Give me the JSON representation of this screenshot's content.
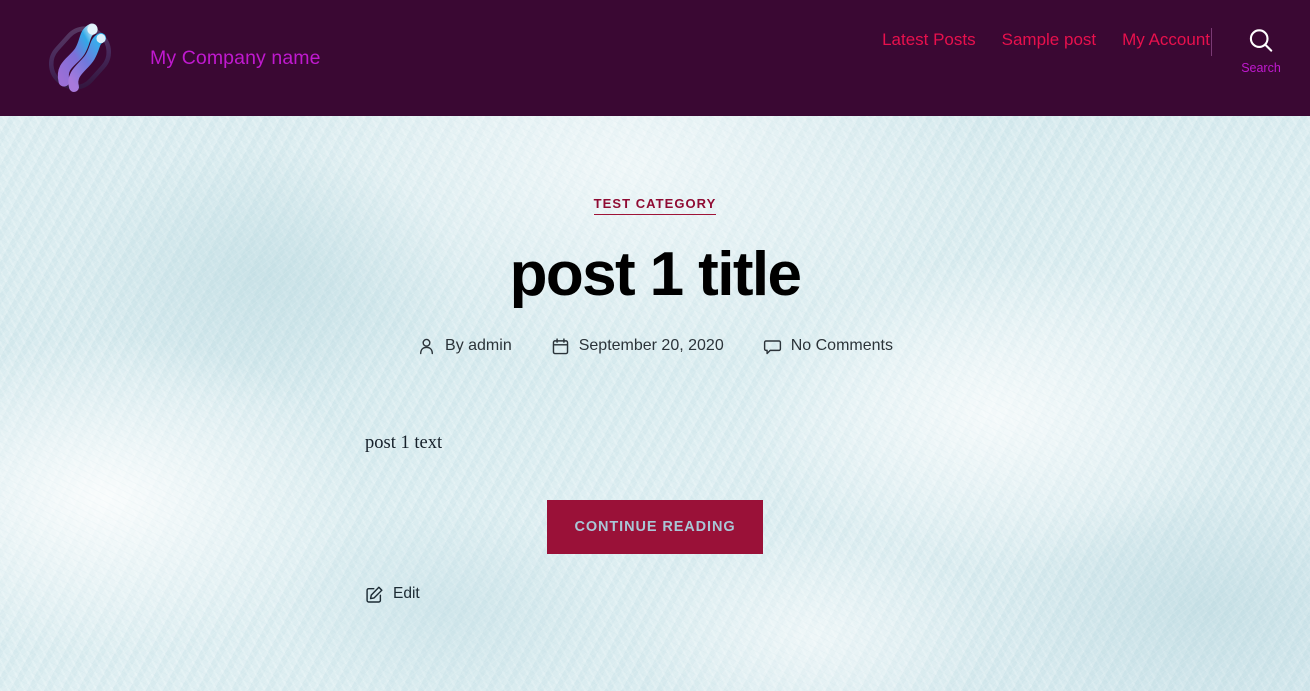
{
  "header": {
    "logo_icon": "company-logo-ribbon-icon",
    "site_title": "My Company name",
    "nav_items": [
      {
        "label": "Latest Posts"
      },
      {
        "label": "Sample post"
      },
      {
        "label": "My Account"
      }
    ],
    "search": {
      "icon": "search-icon",
      "label": "Search"
    },
    "colors": {
      "background": "#3a0833",
      "brand_text": "#c019cf",
      "nav_link": "#e8104d",
      "divider": "#7a3a74",
      "search_icon": "#ffffff"
    }
  },
  "article": {
    "category": "TEST CATEGORY",
    "title": "post 1 title",
    "meta": {
      "author": {
        "icon": "user-icon",
        "text": "By admin"
      },
      "date": {
        "icon": "calendar-icon",
        "text": "September 20, 2020"
      },
      "comments": {
        "icon": "comment-icon",
        "text": "No Comments"
      }
    },
    "body_text": "post 1 text",
    "more_link_label": "Continue reading",
    "edit_link": {
      "icon": "edit-pencil-icon",
      "label": "Edit"
    },
    "colors": {
      "category": "#8f0b33",
      "title": "#000000",
      "meta_text": "#2b3339",
      "body_text": "#16202a",
      "button_background": "#9a1138",
      "button_text": "#a9c6d6",
      "page_background": "#dceef1"
    }
  }
}
